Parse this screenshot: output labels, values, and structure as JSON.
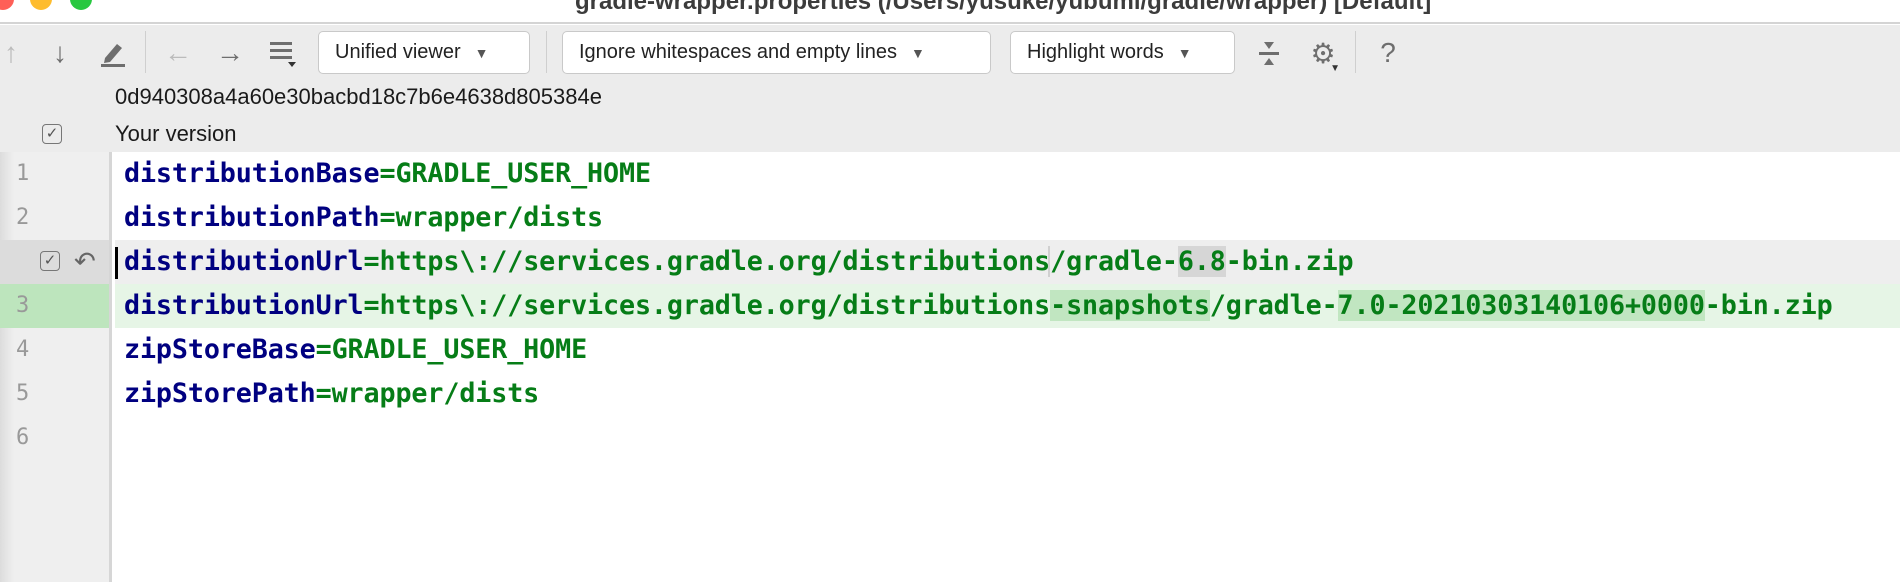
{
  "window": {
    "title": "gradle-wrapper.properties (/Users/yusuke/yubumi/gradle/wrapper) [Default]"
  },
  "toolbar": {
    "icons": [
      "arrow-up-icon",
      "arrow-down-icon",
      "edit-icon",
      "arrow-left-icon",
      "arrow-right-icon",
      "menu-icon",
      "collapse-icon",
      "gear-icon",
      "help-icon"
    ],
    "viewer": "Unified viewer",
    "whitespace": "Ignore whitespaces and empty lines",
    "highlight": "Highlight words",
    "help": "?"
  },
  "header": {
    "revision": "0d940308a4a60e30bacbd18c7b6e4638d805384e",
    "your_version": "Your version",
    "your_version_checked": true
  },
  "colors": {
    "key": "#000080",
    "value": "#067d17",
    "removed_bg": "#eeeeee",
    "added_bg": "#e6f5e6",
    "added_gutter": "#bde5bd"
  },
  "lines": [
    {
      "num": "1",
      "key": "distributionBase",
      "eq": "=",
      "value": "GRADLE_USER_HOME"
    },
    {
      "num": "2",
      "key": "distributionPath",
      "eq": "=",
      "value": "wrapper/dists"
    },
    {
      "num": "",
      "key": "distributionUrl",
      "eq": "=",
      "parts": [
        "https\\://services.gradle.org/distributions",
        "/gradle-",
        "6.8",
        "-bin.zip"
      ]
    },
    {
      "num": "3",
      "key": "distributionUrl",
      "eq": "=",
      "parts": [
        "https\\://services.gradle.org/distributions",
        "-snapshots",
        "/gradle-",
        "7.0-20210303140106+0000",
        "-bin.zip"
      ]
    },
    {
      "num": "4",
      "key": "zipStoreBase",
      "eq": "=",
      "value": "GRADLE_USER_HOME"
    },
    {
      "num": "5",
      "key": "zipStorePath",
      "eq": "=",
      "value": "wrapper/dists"
    },
    {
      "num": "6"
    }
  ]
}
